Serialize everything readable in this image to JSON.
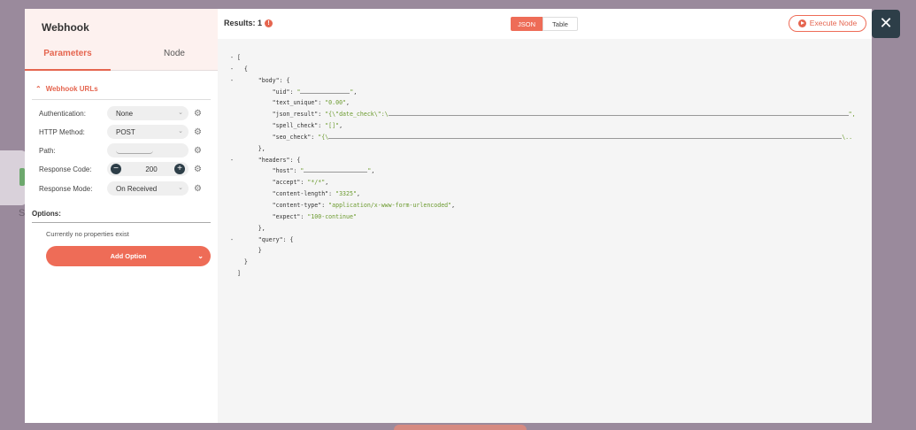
{
  "background": {
    "letter": "S"
  },
  "panel": {
    "node_title": "Webhook",
    "tabs": [
      "Parameters",
      "Node"
    ],
    "section": "Webhook URLs",
    "fields": [
      {
        "label": "Authentication:",
        "value": "None"
      },
      {
        "label": "HTTP Method:",
        "value": "POST"
      },
      {
        "label": "Path:",
        "value": ""
      },
      {
        "label": "Response Code:",
        "value": "200"
      },
      {
        "label": "Response Mode:",
        "value": "On Received"
      }
    ],
    "options_label": "Options:",
    "no_props": "Currently no properties exist",
    "add_option": "Add Option"
  },
  "output": {
    "results": "Results: 1",
    "info_icon": "!",
    "view_json": "JSON",
    "view_table": "Table",
    "execute": "Execute Node",
    "close": "✕",
    "accent_color": "#ee6c57",
    "json": {
      "body": {
        "uid": "",
        "text_unique": "0.00",
        "json_result_prefix": "{\\\"date_check\\\":\\",
        "spell_check": "[]",
        "seo_check_prefix": "{\\"
      },
      "headers": {
        "host": "",
        "accept": "*/*",
        "content_length": "3325",
        "content_type": "application/x-www-form-urlencoded",
        "expect": "100-continue"
      }
    }
  }
}
